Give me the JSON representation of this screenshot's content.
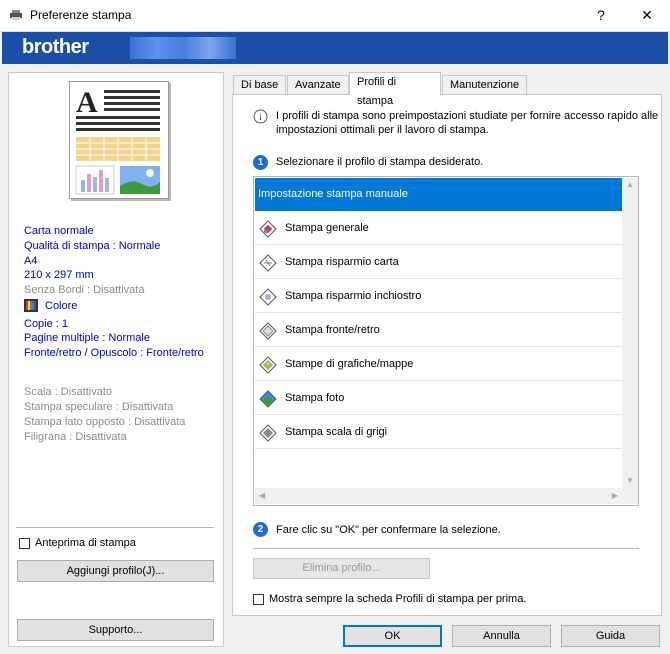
{
  "window": {
    "title": "Preferenze stampa",
    "help_glyph": "?",
    "close_glyph": "✕"
  },
  "banner": {
    "logo": "brother"
  },
  "summary": {
    "paper_type": "Carta normale",
    "quality": "Qualità di stampa : Normale",
    "paper_size": "A4",
    "dimensions": "210 x 297 mm",
    "borderless": "Senza Bordi : Disattivata",
    "color": "Colore",
    "copies": "Copie : 1",
    "multiple_pages": "Pagine multiple : Normale",
    "duplex": "Fronte/retro / Opuscolo : Fronte/retro",
    "scale": "Scala : Disattivato",
    "mirror": "Stampa speculare : Disattivata",
    "reverse": "Stampa lato opposto : Disattivata",
    "watermark": "Filigrana : Disattivata"
  },
  "left_controls": {
    "preview_label": "Anteprima di stampa",
    "preview_checked": false,
    "add_profile": "Aggiungi profilo(J)...",
    "support": "Supporto..."
  },
  "tabs": [
    {
      "label": "Di base",
      "selected": false
    },
    {
      "label": "Avanzate",
      "selected": false
    },
    {
      "label": "Profili di stampa",
      "selected": true
    },
    {
      "label": "Manutenzione",
      "selected": false
    }
  ],
  "profiles_tab": {
    "info_text_line1": "I profili di stampa sono preimpostazioni studiate per fornire accesso rapido alle",
    "info_text_line2": "impostazioni ottimali per il lavoro di stampa.",
    "step1_num": "1",
    "step1_text": "Selezionare il profilo di stampa desiderato.",
    "profiles": [
      {
        "label": "Impostazione stampa manuale",
        "selected": true,
        "icon": "none"
      },
      {
        "label": "Stampa generale",
        "selected": false,
        "icon": "general-print-icon"
      },
      {
        "label": "Stampa risparmio carta",
        "selected": false,
        "icon": "paper-saving-icon"
      },
      {
        "label": "Stampa risparmio inchiostro",
        "selected": false,
        "icon": "ink-saving-icon"
      },
      {
        "label": "Stampa fronte/retro",
        "selected": false,
        "icon": "duplex-icon"
      },
      {
        "label": "Stampe di grafiche/mappe",
        "selected": false,
        "icon": "graphics-icon"
      },
      {
        "label": "Stampa foto",
        "selected": false,
        "icon": "photo-icon"
      },
      {
        "label": "Stampa scala di grigi",
        "selected": false,
        "icon": "grayscale-icon"
      }
    ],
    "step2_num": "2",
    "step2_text": "Fare clic su \"OK\" per confermare la selezione.",
    "delete_profile": "Elimina profilo...",
    "always_show_label": "Mostra sempre la scheda Profili di stampa per prima.",
    "always_show_checked": false
  },
  "footer": {
    "ok": "OK",
    "cancel": "Annulla",
    "help": "Guida"
  },
  "colors": {
    "brand_blue": "#1b4fa8",
    "selection": "#0078d7",
    "step_circle": "#1e6ad9"
  }
}
